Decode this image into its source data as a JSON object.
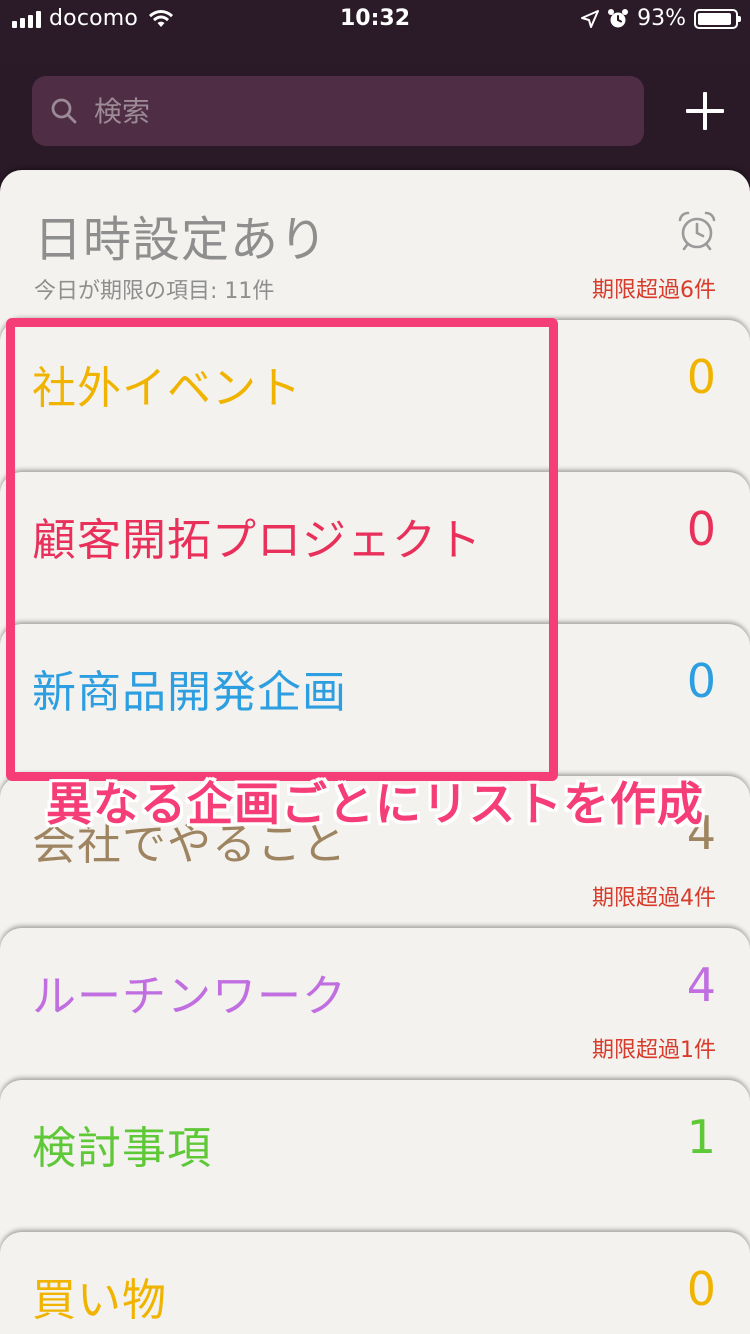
{
  "status_bar": {
    "carrier": "docomo",
    "time": "10:32",
    "battery_text": "93%",
    "battery_level": 0.93,
    "icons": [
      "signal-icon",
      "wifi-icon",
      "location-icon",
      "alarm-icon",
      "battery-icon"
    ]
  },
  "search": {
    "placeholder": "検索"
  },
  "scheduled": {
    "title": "日時設定あり",
    "subtitle": "今日が期限の項目: 11件",
    "overdue": "期限超過6件",
    "icon": "alarm-clock-icon"
  },
  "lists": [
    {
      "name": "社外イベント",
      "count": "0",
      "overdue": "",
      "color": "#f0b400"
    },
    {
      "name": "顧客開拓プロジェクト",
      "count": "0",
      "overdue": "",
      "color": "#e8305a"
    },
    {
      "name": "新商品開発企画",
      "count": "0",
      "overdue": "",
      "color": "#2d9ee0"
    },
    {
      "name": "会社でやること",
      "count": "4",
      "overdue": "期限超過4件",
      "color": "#9e8460"
    },
    {
      "name": "ルーチンワーク",
      "count": "4",
      "overdue": "期限超過1件",
      "color": "#c16ee0"
    },
    {
      "name": "検討事項",
      "count": "1",
      "overdue": "",
      "color": "#5ec837"
    },
    {
      "name": "買い物",
      "count": "0",
      "overdue": "",
      "color": "#f0b400"
    }
  ],
  "annotation": {
    "text": "異なる企画ごとにリストを作成",
    "color": "#f53d77"
  }
}
